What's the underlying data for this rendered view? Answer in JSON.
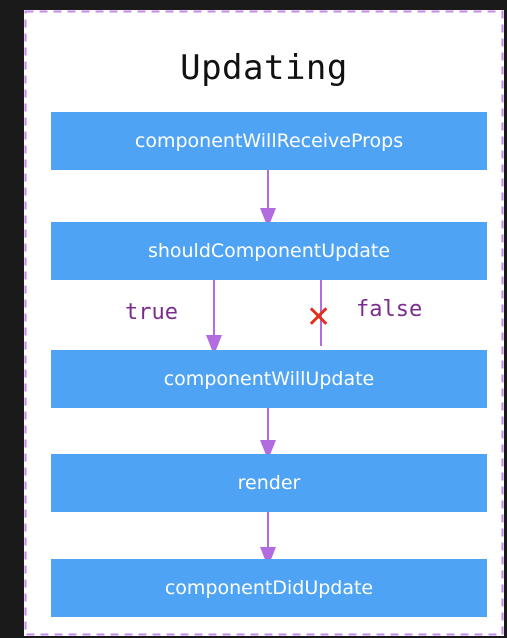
{
  "diagram": {
    "title": "Updating",
    "nodes": [
      {
        "id": "cwrp",
        "label": "componentWillReceiveProps"
      },
      {
        "id": "scu",
        "label": "shouldComponentUpdate"
      },
      {
        "id": "cwu",
        "label": "componentWillUpdate"
      },
      {
        "id": "render",
        "label": "render"
      },
      {
        "id": "cdu",
        "label": "componentDidUpdate"
      }
    ],
    "edges": [
      {
        "from": "cwrp",
        "to": "scu"
      },
      {
        "from": "scu",
        "to": "cwu",
        "label": "true"
      },
      {
        "from": "scu",
        "to": "cwu",
        "label": "false",
        "blocked": true
      },
      {
        "from": "cwu",
        "to": "render"
      },
      {
        "from": "render",
        "to": "cdu"
      }
    ],
    "branch_labels": {
      "true_label": "true",
      "false_label": "false",
      "blocked_mark": "✕"
    },
    "colors": {
      "node_fill": "#4ea3f5",
      "node_text": "#ffffff",
      "arrow": "#b36be0",
      "border": "#c48ae8",
      "branch_label": "#7b2d8e",
      "blocked_mark": "#e0301e"
    }
  }
}
